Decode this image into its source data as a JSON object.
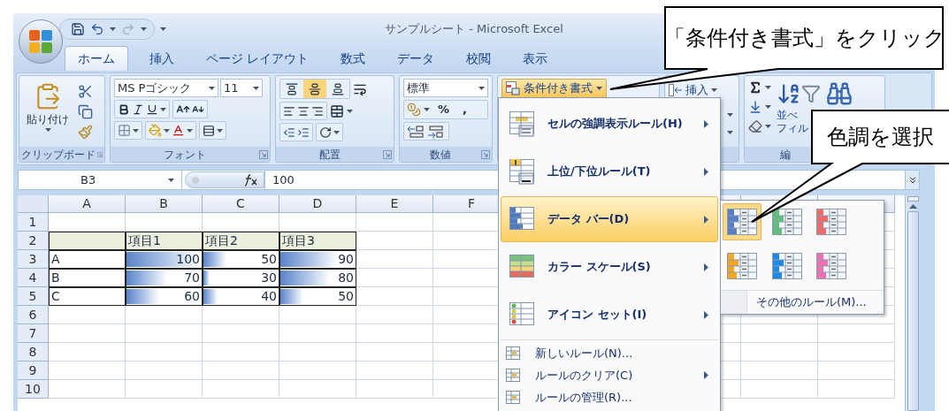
{
  "window": {
    "title": "サンプルシート - Microsoft Excel"
  },
  "tabs": [
    {
      "label": "ホーム",
      "selected": true
    },
    {
      "label": "挿入",
      "selected": false
    },
    {
      "label": "ページ レイアウト",
      "selected": false
    },
    {
      "label": "数式",
      "selected": false
    },
    {
      "label": "データ",
      "selected": false
    },
    {
      "label": "校閲",
      "selected": false
    },
    {
      "label": "表示",
      "selected": false
    }
  ],
  "ribbon": {
    "clipboard": {
      "paste_label": "貼り付け",
      "group_label": "クリップボード"
    },
    "font": {
      "name": "MS Pゴシック",
      "size": "11",
      "group_label": "フォント"
    },
    "alignment": {
      "vertical_buttons": [
        {
          "selected": false
        },
        {
          "selected": true
        },
        {
          "selected": false
        }
      ],
      "group_label": "配置"
    },
    "number": {
      "format": "標準",
      "percent": "%",
      "comma": ",",
      "group_label": "数値"
    },
    "styles": {
      "conditional_formatting": "条件付き書式",
      "open": true
    },
    "cells": {
      "insert": "挿入"
    },
    "editing": {
      "sort_label": "並べ",
      "filter_label": "フィル",
      "group_label": "編"
    }
  },
  "formula_bar": {
    "name_box": "B3",
    "formula": "100"
  },
  "sheet": {
    "columns": [
      "A",
      "B",
      "C",
      "D",
      "E",
      "F"
    ],
    "rows": [
      {
        "header": "1"
      },
      {
        "header": "2",
        "cells": [
          {
            "kind": "header"
          },
          {
            "kind": "header",
            "text": "項目1"
          },
          {
            "kind": "header",
            "text": "項目2"
          },
          {
            "kind": "header",
            "text": "項目3"
          }
        ]
      },
      {
        "header": "3",
        "cells": [
          {
            "kind": "text",
            "text": "A"
          },
          {
            "kind": "databar",
            "text": "100",
            "level": 0.96
          },
          {
            "kind": "databar",
            "text": "50",
            "level": 0.31
          },
          {
            "kind": "databar",
            "text": "90",
            "level": 0.77
          }
        ]
      },
      {
        "header": "4",
        "cells": [
          {
            "kind": "text",
            "text": "B"
          },
          {
            "kind": "databar",
            "text": "70",
            "level": 0.54
          },
          {
            "kind": "databar",
            "text": "30",
            "level": 0.08
          },
          {
            "kind": "databar",
            "text": "80",
            "level": 0.66
          }
        ]
      },
      {
        "header": "5",
        "cells": [
          {
            "kind": "text",
            "text": "C"
          },
          {
            "kind": "databar",
            "text": "60",
            "level": 0.44
          },
          {
            "kind": "databar",
            "text": "40",
            "level": 0.19
          },
          {
            "kind": "databar",
            "text": "50",
            "level": 0.31
          }
        ]
      },
      {
        "header": "6"
      },
      {
        "header": "7"
      },
      {
        "header": "8"
      },
      {
        "header": "9"
      },
      {
        "header": "10"
      }
    ]
  },
  "menu": {
    "items": [
      {
        "label": "セルの強調表示ルール(H)",
        "kind": "large",
        "submenu": true,
        "selected": false
      },
      {
        "label": "上位/下位ルール(T)",
        "kind": "large",
        "submenu": true,
        "selected": false
      },
      {
        "label": "データ バー(D)",
        "kind": "large",
        "submenu": true,
        "selected": true
      },
      {
        "label": "カラー スケール(S)",
        "kind": "large",
        "submenu": true,
        "selected": false
      },
      {
        "label": "アイコン セット(I)",
        "kind": "large",
        "submenu": true,
        "selected": false
      },
      {
        "label": "新しいルール(N)...",
        "kind": "small",
        "submenu": false,
        "selected": false
      },
      {
        "label": "ルールのクリア(C)",
        "kind": "small",
        "submenu": true,
        "selected": false
      },
      {
        "label": "ルールの管理(R)...",
        "kind": "small",
        "submenu": false,
        "selected": false
      }
    ]
  },
  "submenu": {
    "swatches": [
      {
        "color": "#5b7fc4",
        "selected": true
      },
      {
        "color": "#63be7b",
        "selected": false
      },
      {
        "color": "#f06a6a",
        "selected": false
      },
      {
        "color": "#f5a623",
        "selected": false
      },
      {
        "color": "#1e88e5",
        "selected": false
      },
      {
        "color": "#f06fb0",
        "selected": false
      }
    ],
    "more": "その他のルール(M)..."
  },
  "callouts": [
    {
      "text": "「条件付き書式」をクリック"
    },
    {
      "text": "色調を選択"
    }
  ]
}
